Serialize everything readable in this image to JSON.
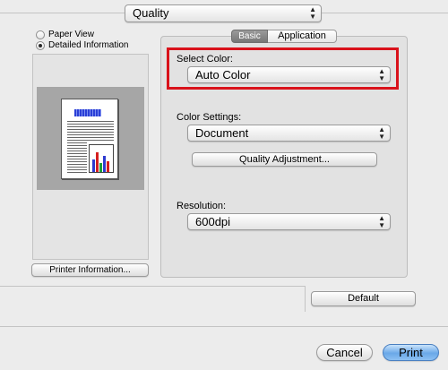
{
  "top_menu": {
    "selected": "Quality"
  },
  "view_mode": {
    "options": [
      "Paper View",
      "Detailed Information"
    ],
    "selected_index": 1
  },
  "left": {
    "printer_info_button": "Printer Information..."
  },
  "tabs": [
    {
      "label": "Basic",
      "active": true
    },
    {
      "label": "Application",
      "active": false
    }
  ],
  "select_color": {
    "label": "Select Color:",
    "value": "Auto Color"
  },
  "color_settings": {
    "label": "Color Settings:",
    "value": "Document"
  },
  "quality_adjustment_button": "Quality Adjustment...",
  "resolution": {
    "label": "Resolution:",
    "value": "600dpi"
  },
  "default_button": "Default",
  "cancel_button": "Cancel",
  "print_button": "Print",
  "colors": {
    "highlight_box": "#d9121b",
    "print_button_blue": "#6aa8e8",
    "tab_active": "#8b8b8b"
  }
}
